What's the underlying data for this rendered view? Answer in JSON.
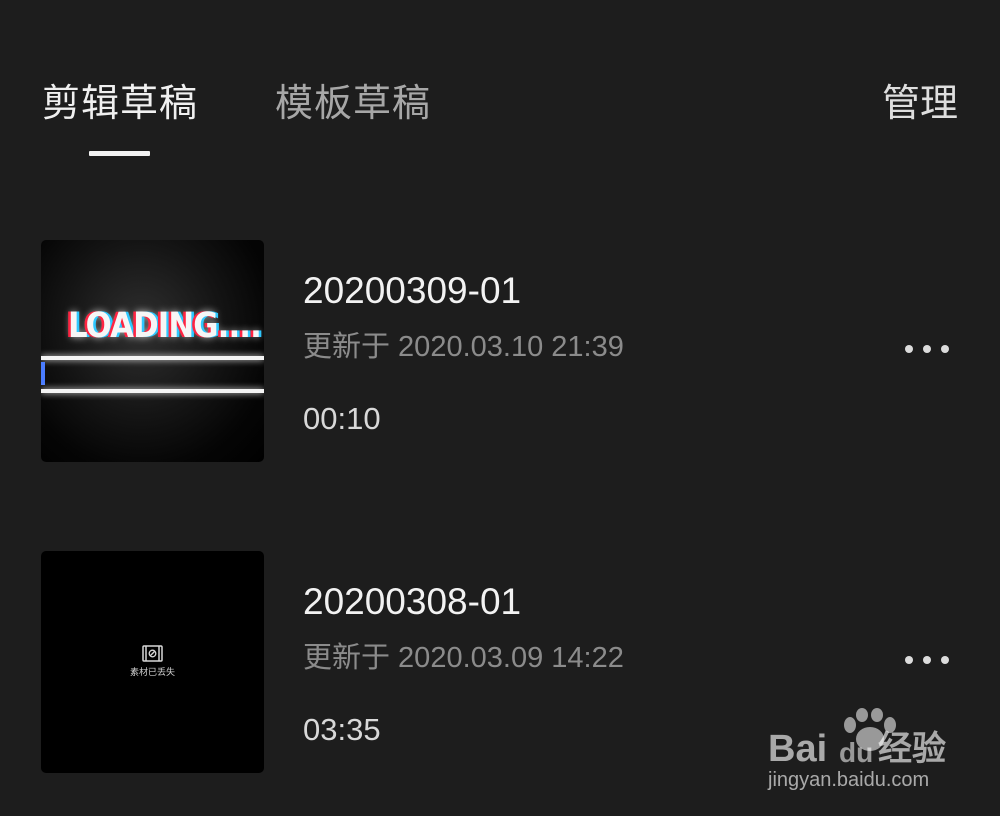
{
  "tabs": {
    "active": "剪辑草稿",
    "inactive": "模板草稿",
    "manage_label": "管理"
  },
  "drafts": [
    {
      "title": "20200309-01",
      "updated": "更新于 2020.03.10 21:39",
      "duration": "00:10",
      "thumbnail_text": "LOADING...."
    },
    {
      "title": "20200308-01",
      "updated": "更新于 2020.03.09 14:22",
      "duration": "03:35",
      "thumbnail_text": "素材已丢失"
    }
  ],
  "watermark": {
    "brand_left": "Bai",
    "brand_mid": "du",
    "brand_cn": "经验",
    "url": "jingyan.baidu.com"
  },
  "colors": {
    "background": "#1d1d1d",
    "active_text": "#f0f0f0",
    "inactive_text": "#a7a7a7",
    "secondary_text": "#8b8b8b"
  },
  "icons": {
    "more": "more-horizontal-icon",
    "missing_media": "film-missing-icon",
    "watermark_logo": "baidu-paw-icon"
  }
}
